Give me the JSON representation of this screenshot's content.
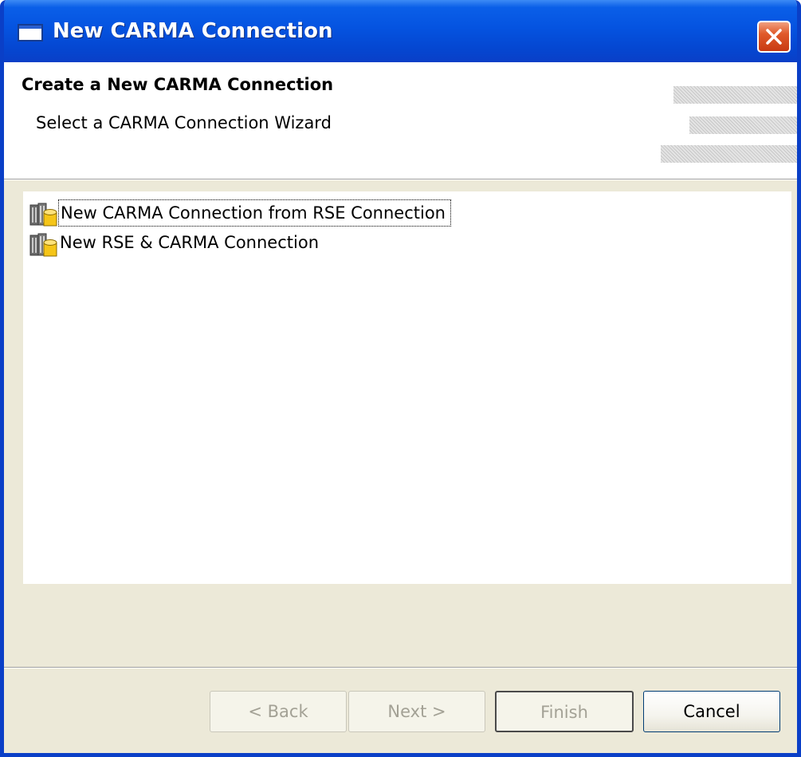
{
  "window": {
    "title": "New CARMA Connection"
  },
  "header": {
    "title": "Create a New CARMA Connection",
    "description": "Select a CARMA Connection Wizard"
  },
  "wizards": [
    {
      "label": "New CARMA Connection from RSE Connection",
      "icon": "connection-icon",
      "focused": true
    },
    {
      "label": "New RSE & CARMA Connection",
      "icon": "connection-icon",
      "focused": false
    }
  ],
  "buttons": {
    "back": {
      "label": "< Back",
      "enabled": false
    },
    "next": {
      "label": "Next >",
      "enabled": false
    },
    "finish": {
      "label": "Finish",
      "enabled": false
    },
    "cancel": {
      "label": "Cancel",
      "enabled": true
    }
  },
  "colors": {
    "titlebar": "#0553e0",
    "close": "#e05a2a",
    "dialog_background": "#ece9d8",
    "icon_yellow": "#f5c518"
  }
}
